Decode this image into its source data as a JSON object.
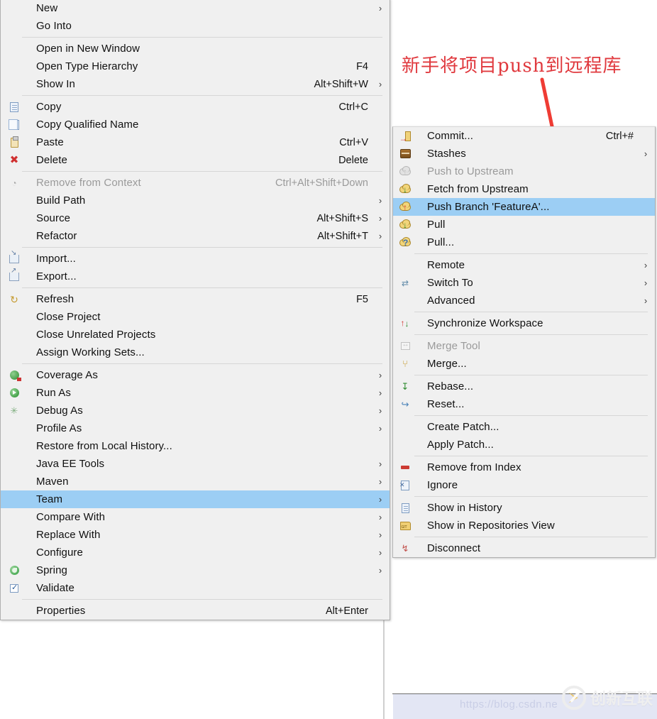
{
  "annotation": {
    "text": "新手将项目push到远程库",
    "color": "#e0393e",
    "arrow_color": "#ef3c34"
  },
  "watermark": {
    "brand": "创新互联",
    "url": "https://blog.csdn.ne"
  },
  "context_menu": {
    "name": "project-context-menu",
    "items": [
      {
        "label": "New",
        "accel": "",
        "icon": "",
        "submenu": true,
        "disabled": false
      },
      {
        "label": "Go Into",
        "accel": "",
        "icon": "",
        "submenu": false,
        "disabled": false
      },
      {
        "separator": true
      },
      {
        "label": "Open in New Window",
        "accel": "",
        "icon": "",
        "submenu": false,
        "disabled": false
      },
      {
        "label": "Open Type Hierarchy",
        "accel": "F4",
        "icon": "",
        "submenu": false,
        "disabled": false
      },
      {
        "label": "Show In",
        "accel": "Alt+Shift+W",
        "icon": "",
        "submenu": true,
        "disabled": false
      },
      {
        "separator": true
      },
      {
        "label": "Copy",
        "accel": "Ctrl+C",
        "icon": "copy-icon",
        "submenu": false,
        "disabled": false
      },
      {
        "label": "Copy Qualified Name",
        "accel": "",
        "icon": "copy-qualified-icon",
        "submenu": false,
        "disabled": false
      },
      {
        "label": "Paste",
        "accel": "Ctrl+V",
        "icon": "paste-icon",
        "submenu": false,
        "disabled": false
      },
      {
        "label": "Delete",
        "accel": "Delete",
        "icon": "delete-icon",
        "submenu": false,
        "disabled": false
      },
      {
        "separator": true
      },
      {
        "label": "Remove from Context",
        "accel": "Ctrl+Alt+Shift+Down",
        "icon": "remove-context-icon",
        "submenu": false,
        "disabled": true
      },
      {
        "label": "Build Path",
        "accel": "",
        "icon": "",
        "submenu": true,
        "disabled": false
      },
      {
        "label": "Source",
        "accel": "Alt+Shift+S",
        "icon": "",
        "submenu": true,
        "disabled": false
      },
      {
        "label": "Refactor",
        "accel": "Alt+Shift+T",
        "icon": "",
        "submenu": true,
        "disabled": false
      },
      {
        "separator": true
      },
      {
        "label": "Import...",
        "accel": "",
        "icon": "import-icon",
        "submenu": false,
        "disabled": false
      },
      {
        "label": "Export...",
        "accel": "",
        "icon": "export-icon",
        "submenu": false,
        "disabled": false
      },
      {
        "separator": true
      },
      {
        "label": "Refresh",
        "accel": "F5",
        "icon": "refresh-icon",
        "submenu": false,
        "disabled": false
      },
      {
        "label": "Close Project",
        "accel": "",
        "icon": "",
        "submenu": false,
        "disabled": false
      },
      {
        "label": "Close Unrelated Projects",
        "accel": "",
        "icon": "",
        "submenu": false,
        "disabled": false
      },
      {
        "label": "Assign Working Sets...",
        "accel": "",
        "icon": "",
        "submenu": false,
        "disabled": false
      },
      {
        "separator": true
      },
      {
        "label": "Coverage As",
        "accel": "",
        "icon": "coverage-icon",
        "submenu": true,
        "disabled": false
      },
      {
        "label": "Run As",
        "accel": "",
        "icon": "run-icon",
        "submenu": true,
        "disabled": false
      },
      {
        "label": "Debug As",
        "accel": "",
        "icon": "debug-icon",
        "submenu": true,
        "disabled": false
      },
      {
        "label": "Profile As",
        "accel": "",
        "icon": "",
        "submenu": true,
        "disabled": false
      },
      {
        "label": "Restore from Local History...",
        "accel": "",
        "icon": "",
        "submenu": false,
        "disabled": false
      },
      {
        "label": "Java EE Tools",
        "accel": "",
        "icon": "",
        "submenu": true,
        "disabled": false
      },
      {
        "label": "Maven",
        "accel": "",
        "icon": "",
        "submenu": true,
        "disabled": false
      },
      {
        "label": "Team",
        "accel": "",
        "icon": "",
        "submenu": true,
        "disabled": false,
        "selected": true
      },
      {
        "label": "Compare With",
        "accel": "",
        "icon": "",
        "submenu": true,
        "disabled": false
      },
      {
        "label": "Replace With",
        "accel": "",
        "icon": "",
        "submenu": true,
        "disabled": false
      },
      {
        "label": "Configure",
        "accel": "",
        "icon": "",
        "submenu": true,
        "disabled": false
      },
      {
        "label": "Spring",
        "accel": "",
        "icon": "spring-icon",
        "submenu": true,
        "disabled": false
      },
      {
        "label": "Validate",
        "accel": "",
        "icon": "validate-check-icon",
        "submenu": false,
        "disabled": false
      },
      {
        "separator": true
      },
      {
        "label": "Properties",
        "accel": "Alt+Enter",
        "icon": "",
        "submenu": false,
        "disabled": false
      }
    ]
  },
  "team_menu": {
    "name": "team-submenu",
    "items": [
      {
        "label": "Commit...",
        "accel": "Ctrl+#",
        "icon": "commit-icon",
        "submenu": false,
        "disabled": false
      },
      {
        "label": "Stashes",
        "accel": "",
        "icon": "stashes-icon",
        "submenu": true,
        "disabled": false
      },
      {
        "label": "Push to Upstream",
        "accel": "",
        "icon": "push-upstream-icon",
        "submenu": false,
        "disabled": true
      },
      {
        "label": "Fetch from Upstream",
        "accel": "",
        "icon": "fetch-upstream-icon",
        "submenu": false,
        "disabled": false
      },
      {
        "label": "Push Branch 'FeatureA'...",
        "accel": "",
        "icon": "push-branch-icon",
        "submenu": false,
        "disabled": false,
        "selected": true
      },
      {
        "label": "Pull",
        "accel": "",
        "icon": "pull-icon",
        "submenu": false,
        "disabled": false
      },
      {
        "label": "Pull...",
        "accel": "",
        "icon": "pull-dialog-icon",
        "submenu": false,
        "disabled": false
      },
      {
        "separator": true
      },
      {
        "label": "Remote",
        "accel": "",
        "icon": "",
        "submenu": true,
        "disabled": false
      },
      {
        "label": "Switch To",
        "accel": "",
        "icon": "switch-to-icon",
        "submenu": true,
        "disabled": false
      },
      {
        "label": "Advanced",
        "accel": "",
        "icon": "",
        "submenu": true,
        "disabled": false
      },
      {
        "separator": true
      },
      {
        "label": "Synchronize Workspace",
        "accel": "",
        "icon": "synchronize-icon",
        "submenu": false,
        "disabled": false
      },
      {
        "separator": true
      },
      {
        "label": "Merge Tool",
        "accel": "",
        "icon": "merge-tool-icon",
        "submenu": false,
        "disabled": true
      },
      {
        "label": "Merge...",
        "accel": "",
        "icon": "merge-icon",
        "submenu": false,
        "disabled": false
      },
      {
        "separator": true
      },
      {
        "label": "Rebase...",
        "accel": "",
        "icon": "rebase-icon",
        "submenu": false,
        "disabled": false
      },
      {
        "label": "Reset...",
        "accel": "",
        "icon": "reset-icon",
        "submenu": false,
        "disabled": false
      },
      {
        "separator": true
      },
      {
        "label": "Create Patch...",
        "accel": "",
        "icon": "",
        "submenu": false,
        "disabled": false
      },
      {
        "label": "Apply Patch...",
        "accel": "",
        "icon": "",
        "submenu": false,
        "disabled": false
      },
      {
        "separator": true
      },
      {
        "label": "Remove from Index",
        "accel": "",
        "icon": "remove-index-icon",
        "submenu": false,
        "disabled": false
      },
      {
        "label": "Ignore",
        "accel": "",
        "icon": "ignore-icon",
        "submenu": false,
        "disabled": false
      },
      {
        "separator": true
      },
      {
        "label": "Show in History",
        "accel": "",
        "icon": "history-icon",
        "submenu": false,
        "disabled": false
      },
      {
        "label": "Show in Repositories View",
        "accel": "",
        "icon": "repositories-icon",
        "submenu": false,
        "disabled": false
      },
      {
        "separator": true
      },
      {
        "label": "Disconnect",
        "accel": "",
        "icon": "disconnect-icon",
        "submenu": false,
        "disabled": false
      }
    ]
  }
}
